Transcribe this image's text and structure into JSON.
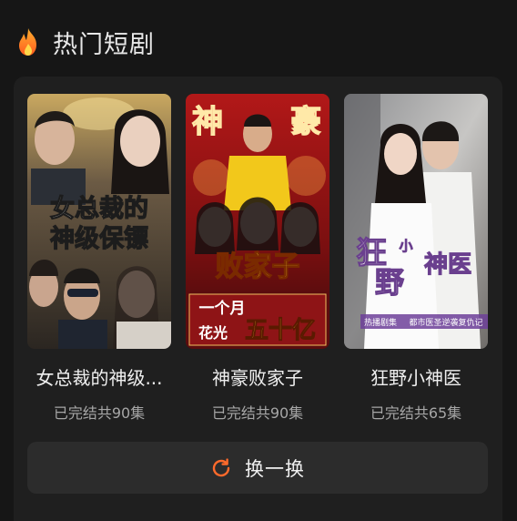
{
  "header": {
    "icon": "fire-icon",
    "title": "热门短剧"
  },
  "dramas": [
    {
      "title": "女总裁的神级...",
      "status": "已完结共90集",
      "poster_text": [
        "女总裁的",
        "神级保镖"
      ]
    },
    {
      "title": "神豪败家子",
      "status": "已完结共90集",
      "poster_text": [
        "神",
        "豪",
        "败家子",
        "一个月",
        "花光",
        "五十亿"
      ]
    },
    {
      "title": "狂野小神医",
      "status": "已完结共65集",
      "poster_text": [
        "狂",
        "小",
        "野",
        "神医",
        "热播剧集",
        "都市医圣逆袭复仇记"
      ]
    }
  ],
  "refresh": {
    "icon": "refresh-icon",
    "label": "换一换"
  },
  "colors": {
    "background": "#161616",
    "panel": "#1f1f1f",
    "button": "#2c2c2c",
    "accent": "#ff6a2b"
  }
}
